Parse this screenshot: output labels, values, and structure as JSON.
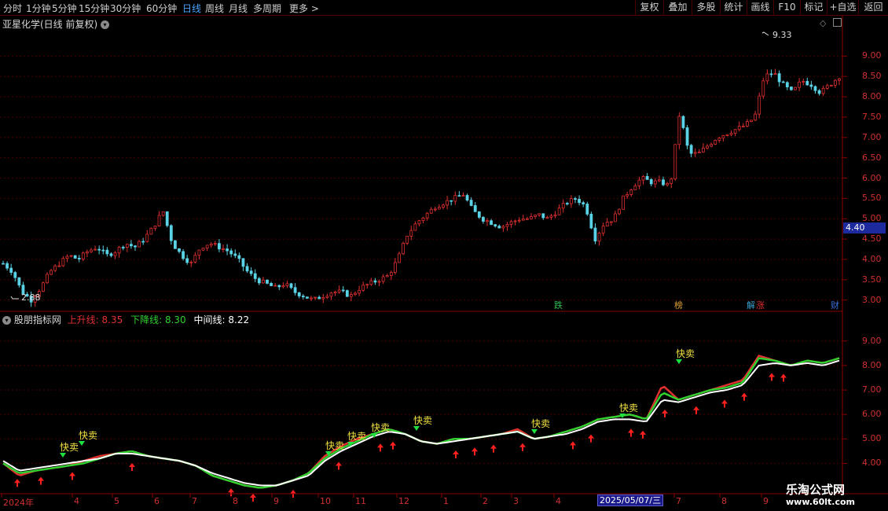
{
  "toolbar": {
    "timeframes": [
      {
        "label": "分时",
        "active": false
      },
      {
        "label": "1分钟",
        "active": false
      },
      {
        "label": "5分钟",
        "active": false
      },
      {
        "label": "15分钟",
        "active": false
      },
      {
        "label": "30分钟",
        "active": false
      },
      {
        "label": "60分钟",
        "active": false
      },
      {
        "label": "日线",
        "active": true
      },
      {
        "label": "周线",
        "active": false
      },
      {
        "label": "月线",
        "active": false
      },
      {
        "label": "多周期",
        "active": false
      },
      {
        "label": "更多 >",
        "active": false
      }
    ],
    "right_buttons": [
      "复权",
      "叠加",
      "多股",
      "统计",
      "画线",
      "F10",
      "标记",
      "+自选",
      "返回"
    ]
  },
  "main_chart": {
    "title": "亚星化学(日线 前复权)",
    "high_label": "9.33",
    "low_label": "2.88",
    "current_price": "4.40",
    "y_ticks": [
      "9.00",
      "8.50",
      "8.00",
      "7.50",
      "7.00",
      "6.50",
      "6.00",
      "5.50",
      "5.00",
      "4.50",
      "4.00",
      "3.50",
      "3.00"
    ],
    "event_badges": [
      {
        "text": "跌",
        "color": "#2fbf4f"
      },
      {
        "text": "榜",
        "color": "#e0a030"
      },
      {
        "text": "解",
        "color": "#3aa0d0"
      },
      {
        "text": "涨",
        "color": "#e03030"
      },
      {
        "text": "财",
        "color": "#3a70e0"
      }
    ]
  },
  "indicator": {
    "name": "股朋指标网",
    "up_label": "上升线:",
    "up_value": "8.35",
    "down_label": "下降线:",
    "down_value": "8.30",
    "mid_label": "中间线:",
    "mid_value": "8.22",
    "y_ticks": [
      "9.00",
      "8.00",
      "7.00",
      "6.00",
      "5.00",
      "4.00"
    ],
    "signal_text": "快卖"
  },
  "x_axis": {
    "months": [
      "2024年",
      "4",
      "5",
      "6",
      "7",
      "8",
      "9",
      "10",
      "11",
      "12",
      "1",
      "2",
      "3",
      "4",
      "7",
      "8",
      "9"
    ],
    "highlight_date": "2025/05/07/三"
  },
  "watermark": {
    "line1": "乐淘公式网",
    "line2": "www.60lt.com"
  },
  "chart_data": {
    "type": "candlestick",
    "title": "亚星化学(日线 前复权)",
    "ylim": [
      2.8,
      9.8
    ],
    "x_start": "2024-03",
    "x_end": "2025-09",
    "close": [
      3.9,
      3.7,
      3.2,
      3.0,
      3.3,
      3.7,
      3.9,
      4.1,
      4.0,
      4.2,
      4.3,
      4.1,
      4.2,
      4.4,
      4.3,
      4.5,
      4.8,
      5.2,
      4.4,
      4.1,
      3.9,
      4.3,
      4.4,
      4.3,
      4.2,
      4.0,
      3.7,
      3.5,
      3.4,
      3.3,
      3.4,
      3.2,
      3.1,
      3.0,
      3.1,
      3.2,
      3.2,
      3.1,
      3.3,
      3.4,
      3.5,
      3.6,
      4.0,
      4.6,
      4.9,
      5.1,
      5.3,
      5.4,
      5.5,
      5.6,
      5.2,
      5.0,
      4.9,
      4.8,
      4.9,
      5.0,
      5.0,
      5.1,
      5.0,
      5.2,
      5.4,
      5.5,
      5.3,
      4.5,
      4.9,
      5.0,
      5.5,
      5.8,
      6.0,
      5.9,
      5.9,
      5.8,
      7.6,
      6.6,
      6.6,
      6.8,
      7.0,
      7.1,
      7.2,
      7.3,
      7.5,
      8.5,
      8.6,
      8.3,
      8.1,
      8.4,
      8.3,
      8.1,
      8.3,
      8.5
    ],
    "up_line": [
      4.0,
      3.5,
      3.7,
      3.8,
      3.9,
      4.1,
      4.3,
      4.4,
      4.5,
      4.3,
      4.2,
      4.1,
      3.9,
      3.5,
      3.3,
      3.1,
      3.0,
      3.1,
      3.3,
      3.6,
      4.3,
      4.7,
      5.0,
      5.2,
      5.4,
      5.2,
      4.9,
      4.8,
      5.0,
      5.0,
      5.1,
      5.2,
      5.4,
      5.0,
      5.1,
      5.3,
      5.5,
      5.8,
      5.9,
      6.0,
      5.8,
      7.2,
      6.6,
      6.8,
      7.0,
      7.2,
      7.4,
      8.4,
      8.2,
      8.0,
      8.2,
      8.1,
      8.3
    ],
    "down_line": [
      4.0,
      3.6,
      3.7,
      3.8,
      3.9,
      4.0,
      4.2,
      4.4,
      4.5,
      4.3,
      4.2,
      4.1,
      3.9,
      3.5,
      3.3,
      3.1,
      3.0,
      3.1,
      3.3,
      3.6,
      4.2,
      4.6,
      4.9,
      5.2,
      5.4,
      5.2,
      4.9,
      4.8,
      5.0,
      5.0,
      5.1,
      5.2,
      5.3,
      5.0,
      5.1,
      5.3,
      5.5,
      5.8,
      5.9,
      6.0,
      5.8,
      6.9,
      6.6,
      6.8,
      7.0,
      7.1,
      7.3,
      8.3,
      8.2,
      8.0,
      8.2,
      8.1,
      8.3
    ],
    "mid_line": [
      4.1,
      3.7,
      3.8,
      3.9,
      4.0,
      4.1,
      4.2,
      4.4,
      4.4,
      4.3,
      4.2,
      4.1,
      3.9,
      3.6,
      3.4,
      3.2,
      3.1,
      3.1,
      3.3,
      3.5,
      4.1,
      4.5,
      4.8,
      5.1,
      5.3,
      5.2,
      4.9,
      4.8,
      4.9,
      5.0,
      5.1,
      5.2,
      5.3,
      5.0,
      5.1,
      5.2,
      5.4,
      5.7,
      5.8,
      5.8,
      5.7,
      6.6,
      6.5,
      6.7,
      6.9,
      7.0,
      7.2,
      8.0,
      8.1,
      8.0,
      8.1,
      8.0,
      8.2
    ]
  }
}
